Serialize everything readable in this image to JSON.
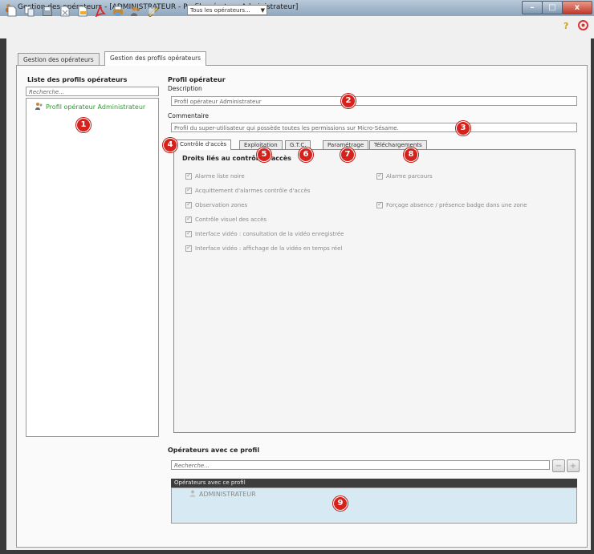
{
  "window": {
    "title": "Gestion des opérateurs - [ADMINISTRATEUR - Profil opérateur Administrateur]"
  },
  "toolbar": {
    "icons": [
      "new-document-icon",
      "duplicate-icon",
      "save-icon",
      "delete-icon",
      "import-icon",
      "pdf-icon",
      "print-icon",
      "users-icon",
      "edit-icon"
    ],
    "filter_selected": "Tous les opérateurs...",
    "help_icon": "help-icon",
    "close_icon": "exit-icon"
  },
  "main_tabs": [
    {
      "label": "Gestion des opérateurs",
      "active": false
    },
    {
      "label": "Gestion des profils opérateurs",
      "active": true
    }
  ],
  "left_panel": {
    "title": "Liste des profils opérateurs",
    "search_placeholder": "Recherche...",
    "profiles": [
      "Profil opérateur Administrateur"
    ]
  },
  "profile": {
    "section_title": "Profil opérateur",
    "description_label": "Description",
    "description_value": "Profil opérateur Administrateur",
    "comment_label": "Commentaire",
    "comment_value": "Profil du super-utilisateur qui possède toutes les permissions sur Micro-Sésame."
  },
  "sub_tabs": [
    {
      "label": "Contrôle d'accès",
      "active": true
    },
    {
      "label": "Exploitation",
      "active": false
    },
    {
      "label": "G.T.C.",
      "active": false
    },
    {
      "label": "Paramétrage",
      "active": false
    },
    {
      "label": "Téléchargements",
      "active": false
    }
  ],
  "access_rights": {
    "title": "Droits liés au contrôle d'accès",
    "left": [
      "Alarme liste noire",
      "Acquittement d'alarmes contrôle d'accès",
      "Observation zones",
      "Contrôle visuel des accès",
      "Interface vidéo : consultation de la vidéo enregistrée",
      "Interface vidéo : affichage de la vidéo en temps réel"
    ],
    "right": [
      "Alarme parcours",
      "Forçage absence / présence badge dans une zone"
    ]
  },
  "operators": {
    "title": "Opérateurs avec ce profil",
    "search_placeholder": "Recherche...",
    "list_header": "Opérateurs avec ce profil",
    "items": [
      "ADMINISTRATEUR"
    ]
  },
  "badges": [
    "1",
    "2",
    "3",
    "4",
    "5",
    "6",
    "7",
    "8",
    "9"
  ],
  "colors": {
    "badge": "#d5221d",
    "profile_link": "#2e9a2e",
    "list_header": "#3d3d3d",
    "list_body": "#d7eaf4"
  }
}
